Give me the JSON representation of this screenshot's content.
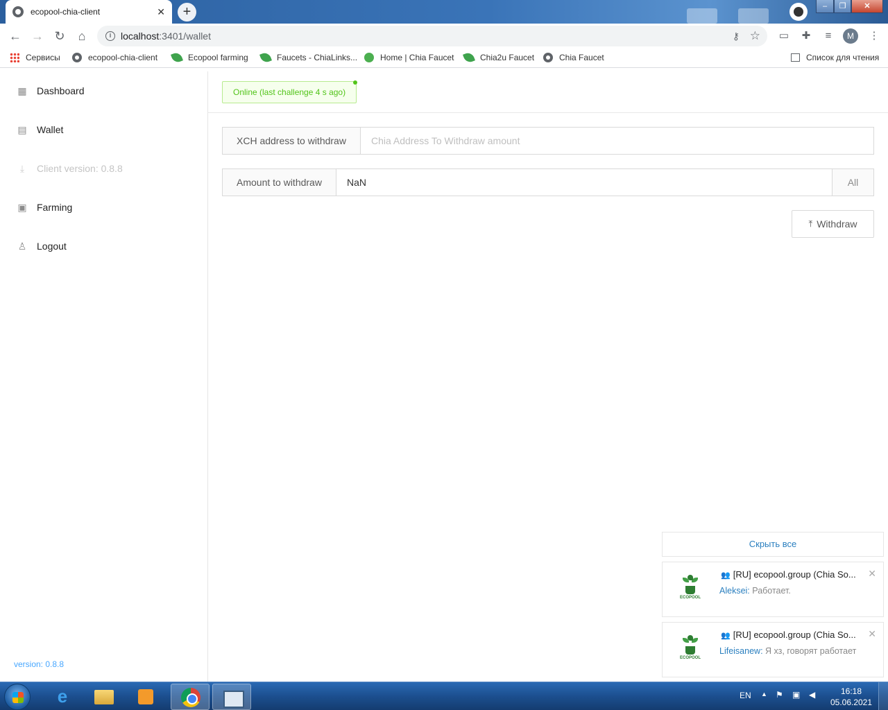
{
  "browser": {
    "tab_title": "ecopool-chia-client",
    "new_tab": "+",
    "url_host": "localhost",
    "url_path": ":3401/wallet",
    "avatar_letter": "M",
    "bookmarks": [
      {
        "label": "Сервисы",
        "icon": "apps-icon"
      },
      {
        "label": "ecopool-chia-client",
        "icon": "globe-icon"
      },
      {
        "label": "Ecopool farming",
        "icon": "leaf-icon"
      },
      {
        "label": "Faucets - ChiaLinks...",
        "icon": "leaf-icon"
      },
      {
        "label": "Home | Chia Faucet",
        "icon": "faucet-icon"
      },
      {
        "label": "Chia2u Faucet",
        "icon": "leaf-icon"
      },
      {
        "label": "Chia Faucet",
        "icon": "globe-icon"
      }
    ],
    "reading_list": "Список для чтения"
  },
  "sidebar": {
    "items": [
      {
        "label": "Dashboard",
        "icon": "chart-icon"
      },
      {
        "label": "Wallet",
        "icon": "wallet-icon"
      },
      {
        "label": "Client version: 0.8.8",
        "icon": "download-icon",
        "disabled": true
      },
      {
        "label": "Farming",
        "icon": "farming-icon"
      },
      {
        "label": "Logout",
        "icon": "user-icon"
      }
    ],
    "version": "version: 0.8.8"
  },
  "header": {
    "status": "Online (last challenge 4 s ago)",
    "status_color": "#52c41a"
  },
  "wallet": {
    "address_label": "XCH address to withdraw",
    "address_placeholder": "Chia Address To Withdraw amount",
    "address_value": "",
    "amount_label": "Amount to withdraw",
    "amount_value": "NaN",
    "all_label": "All",
    "withdraw_label": "Withdraw"
  },
  "notifications": {
    "hide_all": "Скрыть все",
    "items": [
      {
        "title": "[RU] ecopool.group (Chia So...",
        "author": "Aleksei",
        "message": "Работает.",
        "logo_text": "ECOPOOL"
      },
      {
        "title": "[RU] ecopool.group (Chia So...",
        "author": "Lifeisanew",
        "message": "Я хз, говорят работает",
        "logo_text": "ECOPOOL"
      }
    ]
  },
  "taskbar": {
    "lang": "EN",
    "time": "16:18",
    "date": "05.06.2021"
  }
}
